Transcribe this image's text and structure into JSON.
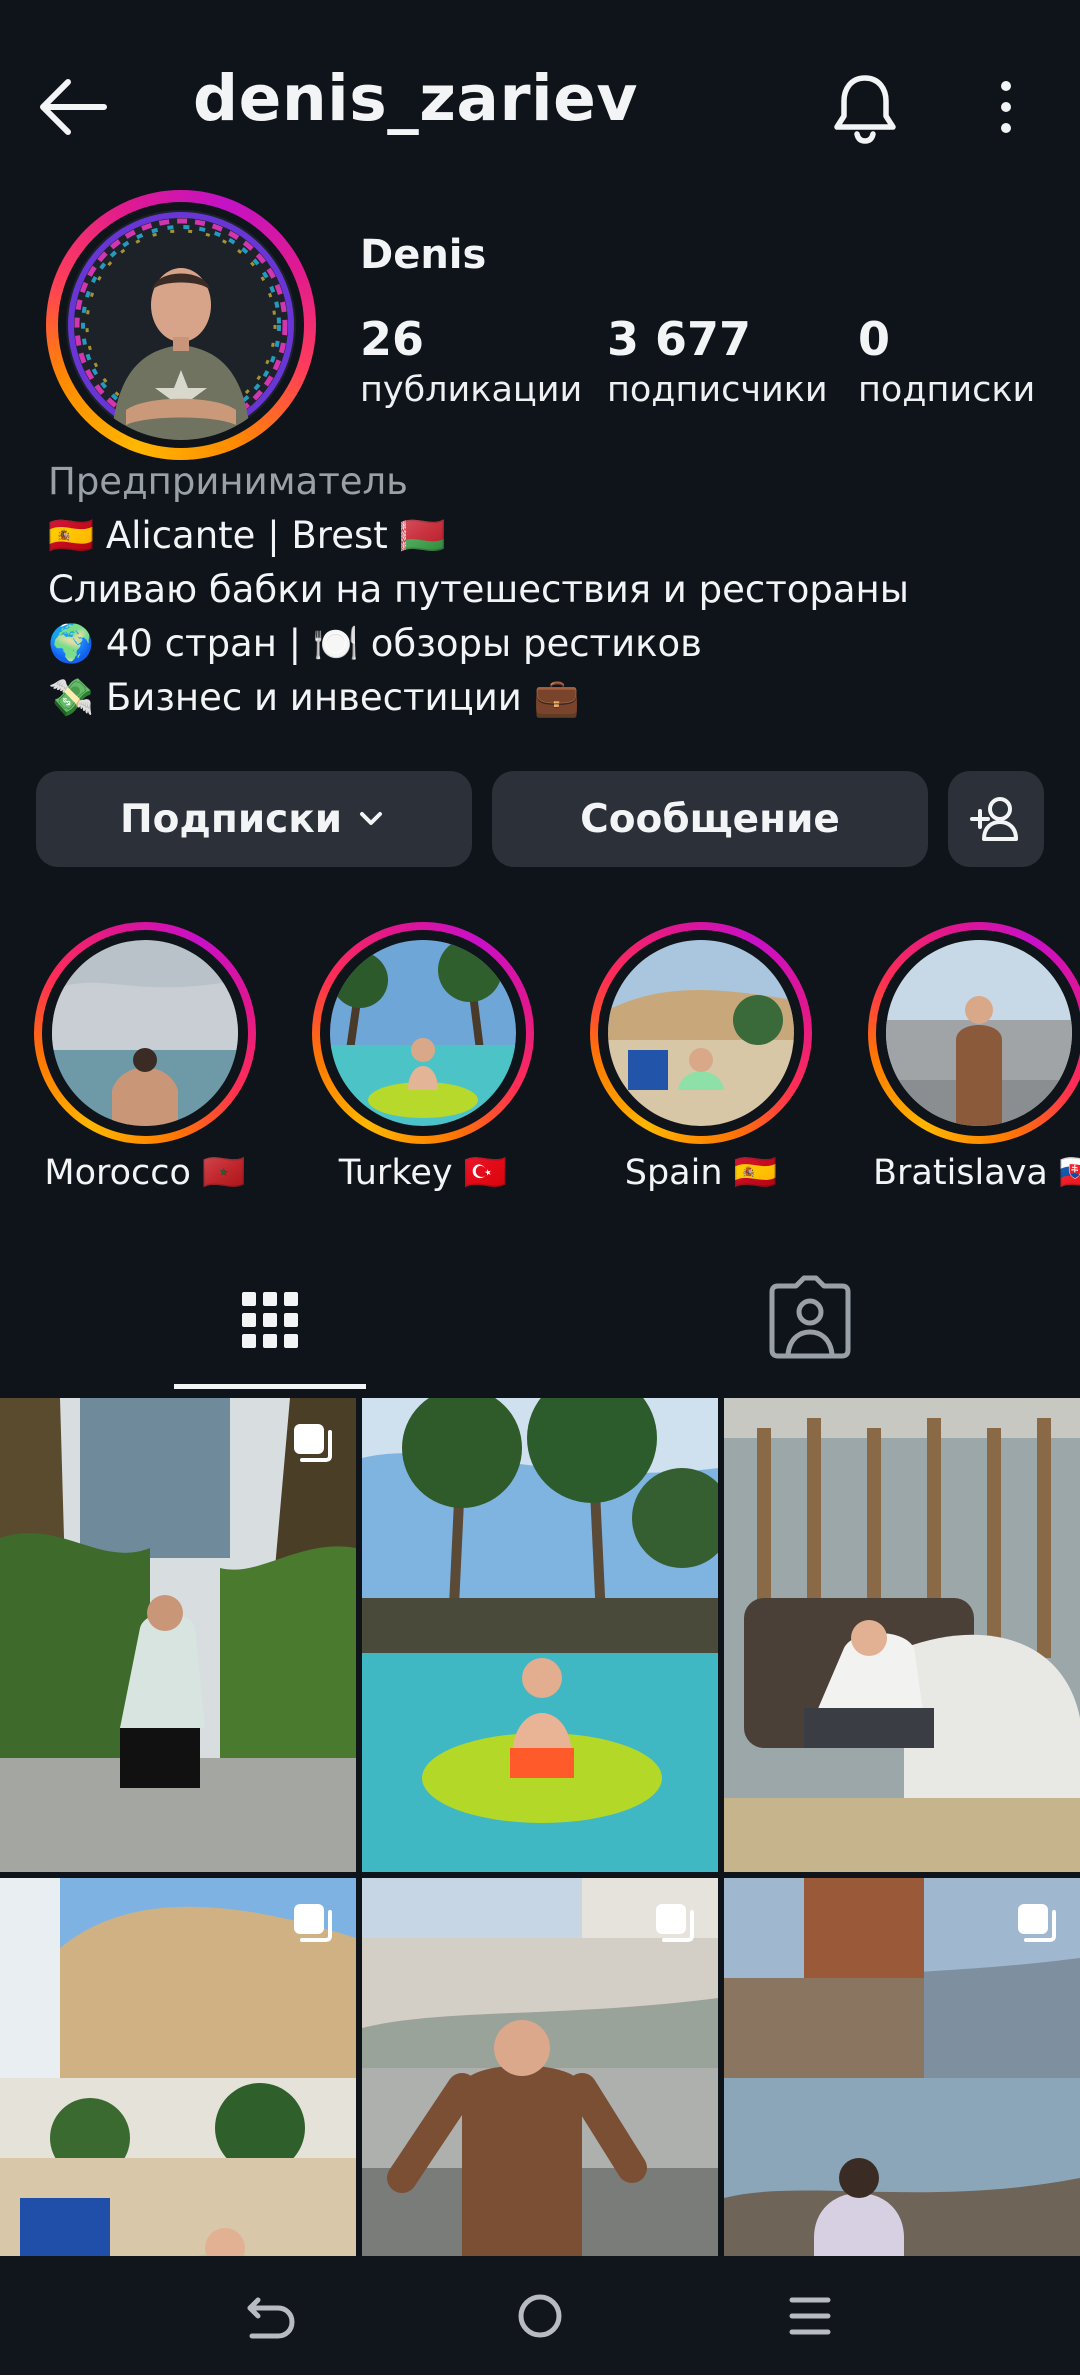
{
  "header": {
    "username": "denis_zariev",
    "icons": [
      "back-arrow-icon",
      "bell-icon",
      "more-vertical-icon"
    ]
  },
  "profile": {
    "display_name": "Denis",
    "stats": [
      {
        "value": "26",
        "label": "публикации"
      },
      {
        "value": "3 677",
        "label": "подписчики"
      },
      {
        "value": "0",
        "label": "подписки"
      }
    ],
    "bio": {
      "category": "Предприниматель",
      "lines": [
        "🇪🇸 Alicante | Brest 🇧🇾",
        "Сливаю бабки на путешествия и рестораны",
        "🌍 40 стран | 🍽️ обзоры рестиков",
        "💸 Бизнес и инвестиции 💼"
      ]
    }
  },
  "actions": {
    "following_label": "Подписки",
    "message_label": "Сообщение",
    "add_person_icon": "add-person-icon"
  },
  "highlights": [
    {
      "label": "Morocco 🇲🇦"
    },
    {
      "label": "Turkey 🇹🇷"
    },
    {
      "label": "Spain 🇪🇸"
    },
    {
      "label": "Bratislava 🇸🇰"
    }
  ],
  "tabs": {
    "grid_icon": "grid-icon",
    "tagged_icon": "tagged-person-icon",
    "active": "grid"
  },
  "posts": [
    {
      "multi": true
    },
    {
      "multi": false
    },
    {
      "multi": false
    },
    {
      "multi": true
    },
    {
      "multi": true
    },
    {
      "multi": true
    }
  ],
  "navbar": {
    "icons": [
      "back-nav-icon",
      "home-circle-icon",
      "recent-apps-icon"
    ]
  },
  "colors": {
    "background": "#0f141b",
    "button_bg": "#2c3038",
    "text": "#f2f4f6",
    "muted_text": "#9aa0a8",
    "ring_gradient_start": "#ffb700",
    "ring_gradient_end": "#c810c8"
  }
}
